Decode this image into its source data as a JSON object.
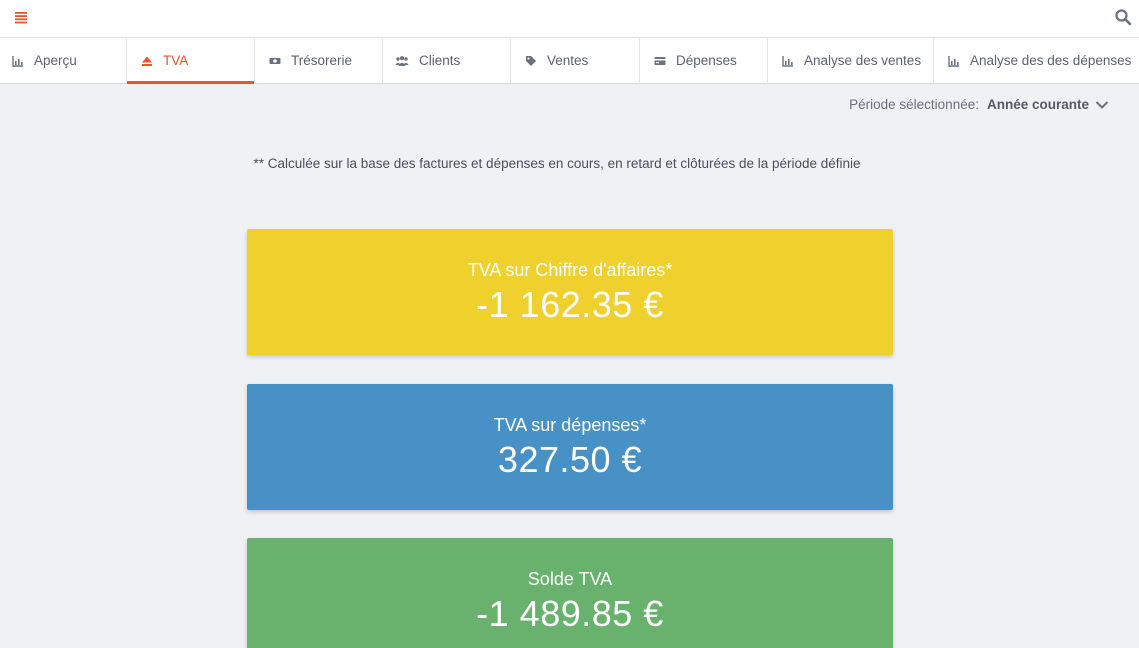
{
  "header": {
    "menu_icon": "hamburger-menu-icon",
    "search_icon": "search-icon",
    "accent_color": "#e8552a"
  },
  "tabs": [
    {
      "label": "Aperçu",
      "icon": "bar-chart-icon",
      "active": false
    },
    {
      "label": "TVA",
      "icon": "eject-icon",
      "active": true
    },
    {
      "label": "Trésorerie",
      "icon": "money-icon",
      "active": false
    },
    {
      "label": "Clients",
      "icon": "users-icon",
      "active": false
    },
    {
      "label": "Ventes",
      "icon": "tags-icon",
      "active": false
    },
    {
      "label": "Dépenses",
      "icon": "credit-card-icon",
      "active": false
    },
    {
      "label": "Analyse des ventes",
      "icon": "bar-chart-icon",
      "active": false
    },
    {
      "label": "Analyse des des dépenses",
      "icon": "bar-chart-icon",
      "active": false
    }
  ],
  "period": {
    "label": "Période sélectionnée:",
    "value": "Année courante",
    "icon": "chevron-down-icon"
  },
  "note": "** Calculée sur la base des factures et dépenses en cours, en retard et clôturées de la période définie",
  "cards": [
    {
      "label": "TVA sur Chiffre d'affaires*",
      "value": "-1 162.35 €",
      "color": "#f0d02c"
    },
    {
      "label": "TVA sur dépenses*",
      "value": "327.50 €",
      "color": "#4791c7"
    },
    {
      "label": "Solde TVA",
      "value": "-1 489.85 €",
      "color": "#69b26d"
    }
  ]
}
